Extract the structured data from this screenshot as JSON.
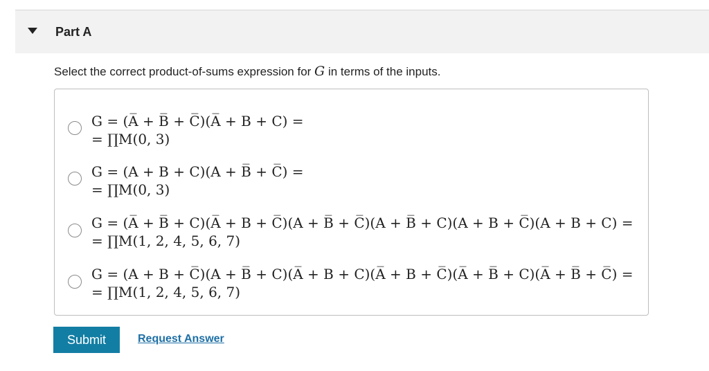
{
  "part": {
    "title": "Part A",
    "caret_icon": "caret-down-icon"
  },
  "question": {
    "prompt_before": "Select the correct product-of-sums expression for ",
    "variable": "G",
    "prompt_after": " in terms of the inputs."
  },
  "options": [
    {
      "line1": "G = (A̅ + B̅ + C̅)(A̅ + B + C) =",
      "line2": "= ∏M(0, 3)"
    },
    {
      "line1": "G = (A + B + C)(A + B̅ + C̅) =",
      "line2": "= ∏M(0, 3)"
    },
    {
      "line1": "G = (A̅ + B̅ + C)(A̅ + B + C̅)(A + B̅ + C̅)(A + B̅ + C)(A + B + C̅)(A + B + C) =",
      "line2": "= ∏M(1, 2, 4, 5, 6, 7)"
    },
    {
      "line1": "G = (A + B + C̅)(A + B̅ + C)(A̅ + B + C)(A̅ + B + C̅)(A̅ + B̅ + C)(A̅ + B̅ + C̅) =",
      "line2": "= ∏M(1, 2, 4, 5, 6, 7)"
    }
  ],
  "buttons": {
    "submit": "Submit",
    "request_answer": "Request Answer"
  },
  "colors": {
    "submit_bg": "#137ea4",
    "link": "#1d6fa5",
    "header_bg": "#f2f2f2"
  }
}
